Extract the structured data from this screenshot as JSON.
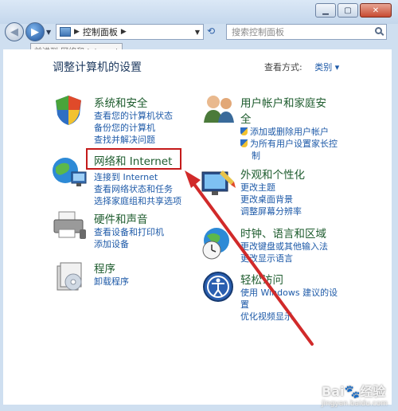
{
  "nav": {
    "address_root": "控制面板",
    "search_placeholder": "搜索控制面板",
    "tooltip": "前进到 网络和 Internet"
  },
  "heading": "调整计算机的设置",
  "view_by": {
    "label": "查看方式:",
    "value": "类别"
  },
  "categories_left": [
    {
      "title": "系统和安全",
      "links": [
        "查看您的计算机状态",
        "备份您的计算机",
        "查找并解决问题"
      ]
    },
    {
      "title": "网络和 Internet",
      "links": [
        "连接到 Internet",
        "查看网络状态和任务",
        "选择家庭组和共享选项"
      ]
    },
    {
      "title": "硬件和声音",
      "links": [
        "查看设备和打印机",
        "添加设备"
      ]
    },
    {
      "title": "程序",
      "links": [
        "卸载程序"
      ]
    }
  ],
  "categories_right": [
    {
      "title_line1": "用户帐户和家庭安",
      "title_line2": "全",
      "links": [
        "添加或删除用户帐户",
        "为所有用户设置家长控",
        "制"
      ]
    },
    {
      "title": "外观和个性化",
      "links": [
        "更改主题",
        "更改桌面背景",
        "调整屏幕分辨率"
      ]
    },
    {
      "title": "时钟、语言和区域",
      "links": [
        "更改键盘或其他输入法",
        "更改显示语言"
      ]
    },
    {
      "title": "轻松访问",
      "links": [
        "使用 Windows 建议的设",
        "置",
        "优化视频显示"
      ]
    }
  ],
  "watermark": {
    "brand": "Bai",
    "brand2": "经验",
    "url": "jingyan.baidu.com"
  },
  "colors": {
    "highlight_border": "#c41a1a",
    "arrow": "#d12a2a",
    "link": "#1e5aa8",
    "title": "#1e5c2e"
  }
}
